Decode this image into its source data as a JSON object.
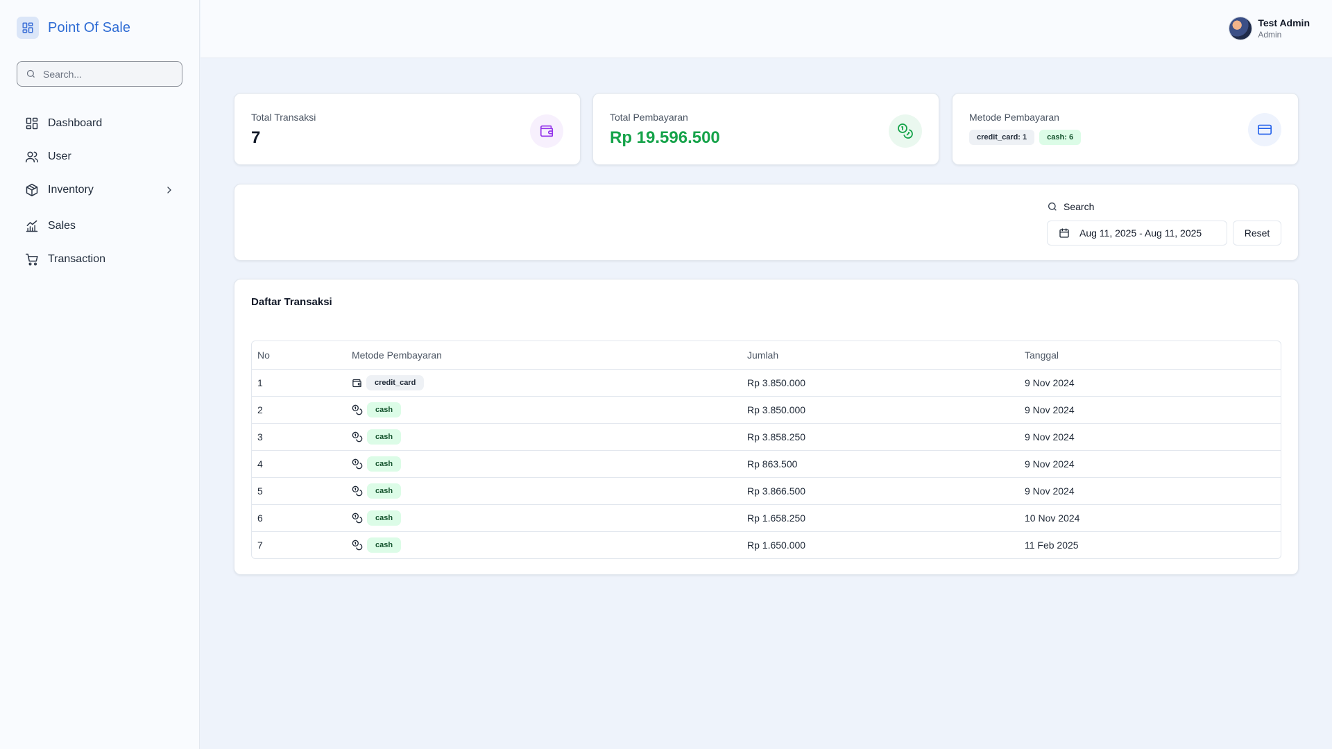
{
  "app": {
    "title": "Point Of Sale",
    "search_placeholder": "Search..."
  },
  "sidebar": {
    "items": [
      {
        "label": "Dashboard",
        "icon": "dashboard-icon"
      },
      {
        "label": "User",
        "icon": "users-icon"
      },
      {
        "label": "Inventory",
        "icon": "box-icon",
        "has_submenu": true
      },
      {
        "label": "Sales",
        "icon": "chart-icon"
      },
      {
        "label": "Transaction",
        "icon": "cart-icon"
      }
    ]
  },
  "user": {
    "name": "Test Admin",
    "role": "Admin"
  },
  "stats": {
    "total_transaksi": {
      "label": "Total Transaksi",
      "value": "7",
      "icon": "wallet-icon",
      "color": "#9333ea"
    },
    "total_pembayaran": {
      "label": "Total Pembayaran",
      "value": "Rp 19.596.500",
      "icon": "coins-icon",
      "color": "#16a34a"
    },
    "metode_pembayaran": {
      "label": "Metode Pembayaran",
      "icon": "credit-card-icon",
      "color": "#2563eb",
      "badges": [
        {
          "text": "credit_card: 1",
          "style": "gray"
        },
        {
          "text": "cash: 6",
          "style": "green"
        }
      ]
    }
  },
  "filter": {
    "search_label": "Search",
    "date_range": "Aug 11, 2025 - Aug 11, 2025",
    "reset_label": "Reset"
  },
  "table": {
    "title": "Daftar Transaksi",
    "columns": [
      "No",
      "Metode Pembayaran",
      "Jumlah",
      "Tanggal"
    ],
    "rows": [
      {
        "no": "1",
        "method": "credit_card",
        "amount": "Rp 3.850.000",
        "date": "9 Nov 2024"
      },
      {
        "no": "2",
        "method": "cash",
        "amount": "Rp 3.850.000",
        "date": "9 Nov 2024"
      },
      {
        "no": "3",
        "method": "cash",
        "amount": "Rp 3.858.250",
        "date": "9 Nov 2024"
      },
      {
        "no": "4",
        "method": "cash",
        "amount": "Rp 863.500",
        "date": "9 Nov 2024"
      },
      {
        "no": "5",
        "method": "cash",
        "amount": "Rp 3.866.500",
        "date": "9 Nov 2024"
      },
      {
        "no": "6",
        "method": "cash",
        "amount": "Rp 1.658.250",
        "date": "10 Nov 2024"
      },
      {
        "no": "7",
        "method": "cash",
        "amount": "Rp 1.650.000",
        "date": "11 Feb 2025"
      }
    ]
  }
}
